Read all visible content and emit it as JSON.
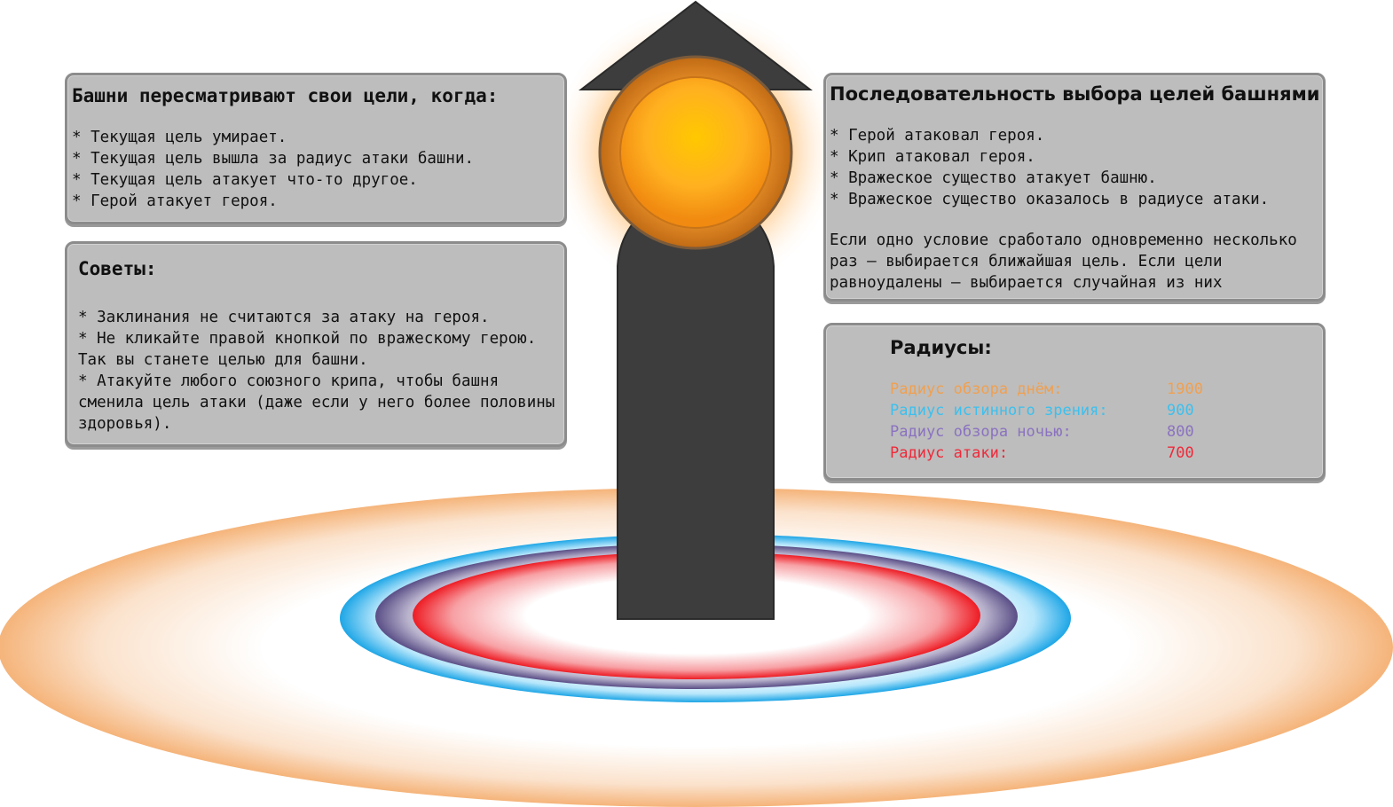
{
  "retarget_panel": {
    "title": "Башни пересматривают свои цели, когда:",
    "items": [
      "* Текущая цель умирает.",
      "* Текущая цель вышла за радиус атаки башни.",
      "* Текущая цель атакует что-то другое.",
      "* Герой атакует героя."
    ]
  },
  "tips_panel": {
    "title": "Советы:",
    "items": [
      "* Заклинания не считаются за атаку на героя.",
      "* Не кликайте правой кнопкой по вражескому герою. Так вы станете целью для башни.",
      "* Атакуйте любого союзного крипа, чтобы башня сменила цель атаки (даже если у него более половины здоровья)."
    ]
  },
  "priority_panel": {
    "title": "Последовательность выбора целей башнями",
    "items": [
      "* Герой атаковал героя.",
      "* Крип атаковал героя.",
      "* Вражеское существо атакует башню.",
      "* Вражеское существо оказалось в радиусе атаки."
    ],
    "note": "Если одно условие сработало одновременно несколько раз – выбирается ближайшая цель. Если цели равноудалены – выбирается случайная из них"
  },
  "radii_panel": {
    "title": "Радиусы:",
    "rows": [
      {
        "label": "Радиус обзора днём:",
        "value": "1900",
        "color": "#f0a050"
      },
      {
        "label": "Радиус истинного зрения:",
        "value": "900",
        "color": "#3cc0ee"
      },
      {
        "label": "Радиус обзора ночью:",
        "value": "800",
        "color": "#8a72c0"
      },
      {
        "label": "Радиус атаки:",
        "value": "700",
        "color": "#ee2a3a"
      }
    ]
  },
  "colors": {
    "day_vision": "#f3b07a",
    "true_sight": "#1aa8e6",
    "night_vision": "#6a5a90",
    "attack": "#ee1c24",
    "tower_body": "#3d3d3d",
    "tower_glow": "#ffb000",
    "panel_bg": "#bdbdbd"
  }
}
